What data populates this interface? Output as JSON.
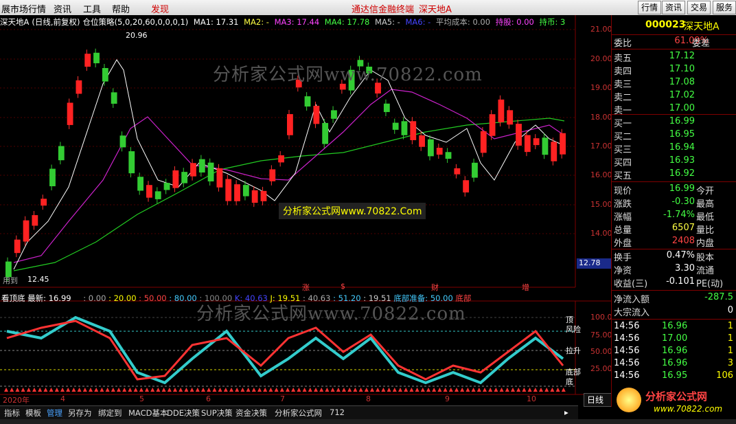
{
  "menubar": {
    "items": [
      "展市场行情",
      "资讯",
      "工具",
      "帮助"
    ],
    "discover": "发现",
    "promo_1": "通达信金融终端",
    "promo_2": "深天地A",
    "right_buttons": [
      "行情",
      "资讯",
      "交易",
      "服务"
    ]
  },
  "infobar": {
    "stock": "深天地A",
    "period": "(日线,前复权)",
    "strategy": "仓位策略(5,0,20,60,0,0,0,1)",
    "ma1": "MA1: 17.31",
    "ma2": "MA2: -",
    "ma3": "MA3: 17.44",
    "ma4": "MA4: 17.78",
    "ma5": "MA5: -",
    "ma6": "MA6: -",
    "avg_cost": "平均成本: 0.00",
    "hold": "持股: 0.00",
    "hold_coin": "持币: 3"
  },
  "price_axis": [
    "21.00",
    "20.00",
    "19.00",
    "18.00",
    "17.00",
    "16.00",
    "15.00",
    "14.00"
  ],
  "price_tag": "12.78",
  "high_label": "20.96",
  "low_label": "12.45",
  "low_prefix": "用到",
  "watermark_text": "分析家公式网www.70822.com",
  "watermark_box": "分析家公式网www.70822.Com",
  "event_marks": [
    "涨",
    "$",
    "财",
    "增"
  ],
  "indicator": {
    "title": "看顶底",
    "latest": "最新: 16.99",
    "values": [
      ": 0.00",
      ": 20.00",
      ": 50.00",
      ": 80.00",
      ": 100.00",
      "K: 40.63",
      "J: 19.51",
      ": 40.63",
      ": 51.20",
      ": 19.51"
    ],
    "bottom_prep": "底部准备: 50.00",
    "bottom_prep_suffix": "底部",
    "axis": [
      "100.00",
      "75.00",
      "50.00",
      "25.00"
    ],
    "right_labels": [
      "顶",
      "风险",
      "拉升",
      "底部",
      "底"
    ]
  },
  "dates": [
    "2020年",
    "4",
    "5",
    "6",
    "7",
    "8",
    "9",
    "10"
  ],
  "tabs": [
    "指标",
    "模板",
    "管理",
    "另存为",
    "绑定到",
    "MACD基本",
    "DDE决策",
    "SUP决策",
    "资金决策",
    "分析家公式网",
    "712"
  ],
  "tab_active": "管理",
  "daybutton": "日线",
  "panel": {
    "code": "000023",
    "name": "深天地A",
    "webi_label": "委比",
    "webi_value": "61.09%",
    "wecha_label": "委差",
    "sells": [
      {
        "label": "卖五",
        "price": "17.12"
      },
      {
        "label": "卖四",
        "price": "17.10"
      },
      {
        "label": "卖三",
        "price": "17.08"
      },
      {
        "label": "卖二",
        "price": "17.02"
      },
      {
        "label": "卖一",
        "price": "17.00"
      }
    ],
    "buys": [
      {
        "label": "买一",
        "price": "16.99"
      },
      {
        "label": "买二",
        "price": "16.95"
      },
      {
        "label": "买三",
        "price": "16.94"
      },
      {
        "label": "买四",
        "price": "16.93"
      },
      {
        "label": "买五",
        "price": "16.92"
      }
    ],
    "stats": [
      {
        "label": "现价",
        "value": "16.99",
        "label2": "今开",
        "color": "#4f4"
      },
      {
        "label": "涨跌",
        "value": "-0.30",
        "label2": "最高",
        "color": "#4f4"
      },
      {
        "label": "涨幅",
        "value": "-1.74%",
        "label2": "最低",
        "color": "#4f4"
      },
      {
        "label": "总量",
        "value": "6507",
        "label2": "量比",
        "color": "#ff4"
      },
      {
        "label": "外盘",
        "value": "2408",
        "label2": "内盘",
        "color": "#f44"
      }
    ],
    "stats2": [
      {
        "label": "换手",
        "value": "0.47%",
        "label2": "股本"
      },
      {
        "label": "净资",
        "value": "3.30",
        "label2": "流通"
      },
      {
        "label": "收益(三)",
        "value": "-0.101",
        "label2": "PE(动)"
      }
    ],
    "flow_label": "净流入额",
    "flow_value": "-287.5",
    "bulk_label": "大宗流入",
    "bulk_value": "0",
    "ticks": [
      {
        "time": "14:56",
        "price": "16.96",
        "vol": "1"
      },
      {
        "time": "14:56",
        "price": "17.00",
        "vol": "1"
      },
      {
        "time": "14:56",
        "price": "16.96",
        "vol": "1"
      },
      {
        "time": "14:56",
        "price": "16.96",
        "vol": "3"
      },
      {
        "time": "14:56",
        "price": "16.95",
        "vol": "106"
      }
    ],
    "logo_text": "分析家公式网",
    "logo_url": "www.70822.com"
  }
}
